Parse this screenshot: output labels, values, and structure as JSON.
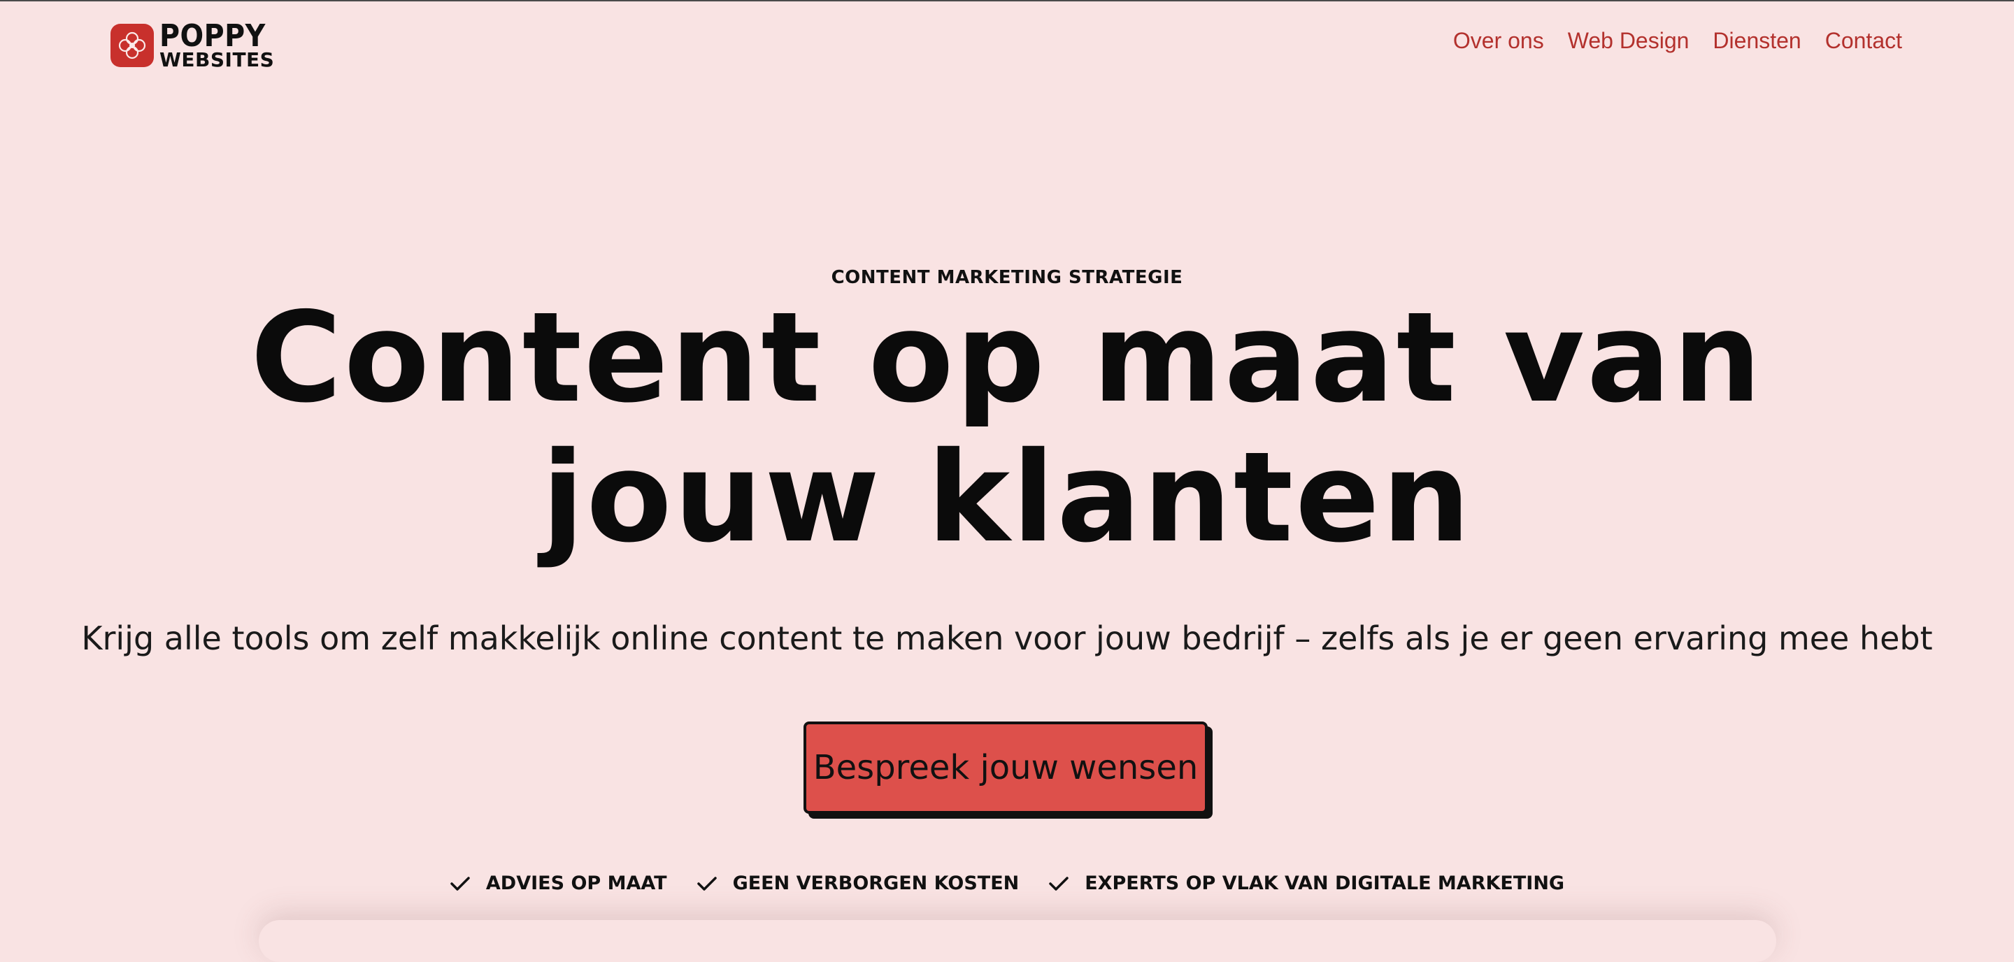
{
  "brand": {
    "line1": "POPPY",
    "line2": "WEBSITES",
    "accent_color": "#c8302c"
  },
  "nav": {
    "items": [
      {
        "label": "Over ons"
      },
      {
        "label": "Web Design"
      },
      {
        "label": "Diensten"
      },
      {
        "label": "Contact"
      }
    ],
    "link_color": "#b3312d"
  },
  "hero": {
    "eyebrow": "CONTENT MARKETING STRATEGIE",
    "headline": "Content op maat van jouw klanten",
    "subline": "Krijg alle tools om zelf makkelijk online content te maken voor jouw bedrijf – zelfs als je er geen ervaring mee hebt",
    "cta_label": "Bespreek jouw wensen",
    "cta_color": "#dd504b",
    "background_color": "#f9e3e3"
  },
  "features": [
    {
      "icon": "check-icon",
      "label": "ADVIES OP MAAT"
    },
    {
      "icon": "check-icon",
      "label": "GEEN VERBORGEN KOSTEN"
    },
    {
      "icon": "check-icon",
      "label": "EXPERTS OP VLAK VAN DIGITALE MARKETING"
    }
  ]
}
